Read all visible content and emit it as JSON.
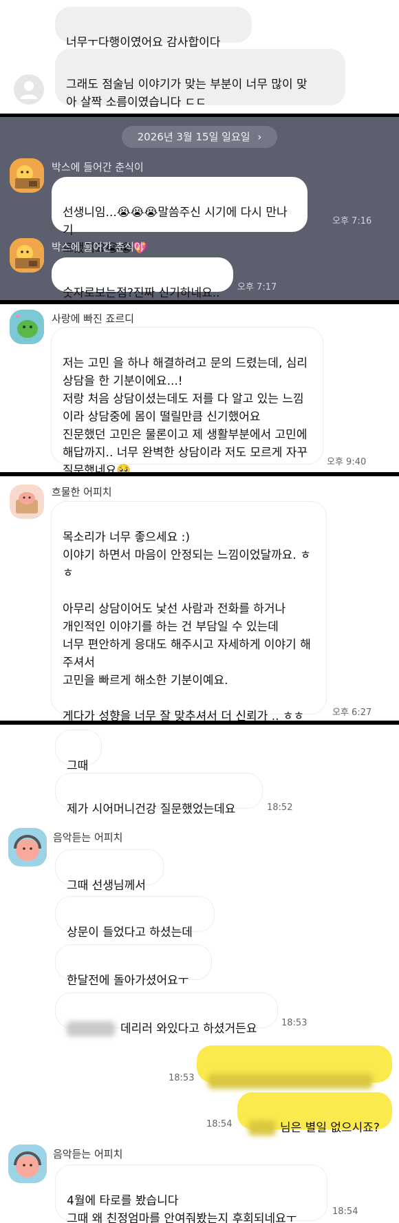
{
  "panel1": {
    "messages": [
      {
        "text": "너무ㅜ다행이였어요 감사합이다"
      },
      {
        "text": "그래도 점술님 이야기가 맞는 부분이 너무 많이 맞\n아 살짝 소름이였습니다 ㄷㄷ"
      }
    ]
  },
  "panel2": {
    "date_label": "2026년 3월 15일 일요일",
    "date_chevron": "›",
    "sender": "박스에 들어간 춘식이",
    "msg1": {
      "text": "선생니임...😭😭😭말씀주신 시기에 다시 만나기\n로했어요😭😭💖",
      "time": "오후 7:16"
    },
    "msg2": {
      "text": "숫자로보는점?진짜 신기하네요..",
      "time": "오후 7:17"
    }
  },
  "panel3": {
    "sender": "사랑에 빠진 죠르디",
    "text": "저는 고민 을 하나 해결하려고 문의 드렸는데, 심리\n상담을 한 기분이에요...!\n저랑 처음 상담이셨는데도 저를 다 알고 있는 느낌\n이라 상담중에 몸이 떨릴만큼 신기했어요\n진문했던 고민은 물론이고 제 생활부분에서 고민에\n해답까지.. 너무 완벽한 상담이라 저도 모르게 자꾸\n질문했네요🥺\n감사합니당 !!! 좋은밤 되세요 !!!",
    "time": "오후 9:40"
  },
  "panel4": {
    "sender": "흐물한 어피치",
    "text": "목소리가 너무 좋으세요 :)\n이야기 하면서 마음이 안정되는 느낌이었달까요. ㅎ\nㅎ\n\n아무리 상담이어도 낯선 사람과 전화를 하거나\n개인적인 이야기를 하는 건 부담일 수 있는데\n너무 편안하게 응대도 해주시고 자세하게 이야기 해\n주셔서\n고민을 빠르게 해소한 기분이예요.\n\n게다가 성향을 너무 잘 맞추셔서 더 신뢰가 .. ㅎㅎ\n덕분에 편안히 하고자 하는 일에 집중할 수 있을 것\n같아요!",
    "time": "오후 6:27"
  },
  "panel5": {
    "top": [
      {
        "text": "그때"
      },
      {
        "text": "제가 시어머니건강 질문했었는데요",
        "time": "18:52"
      }
    ],
    "sender": "음악듣는 어피치",
    "group": [
      {
        "text": "그때 선생님께서"
      },
      {
        "text": "상문이 들었다고 하셨는데"
      },
      {
        "text": "한달전에 돌아가셨어요ㅜ"
      },
      {
        "text": "데리러 와있다고 하셨거든요",
        "time": "18:53"
      }
    ],
    "mine": [
      {
        "time": "18:53"
      },
      {
        "text": "님은 별일 없으시죠?",
        "time": "18:54"
      }
    ],
    "sender2": "음악듣는 어피치",
    "last": {
      "text": "4월에 타로를 봤습니다\n그때 왜 친정엄마를 안여줘봤는지 후회되네요ㅜ",
      "time": "18:54"
    }
  },
  "colors": {
    "dark_panel": "#5c5f6e",
    "chat_bg": "#ffffff",
    "my_bubble": "#fbe94d",
    "divider": "#000000"
  }
}
